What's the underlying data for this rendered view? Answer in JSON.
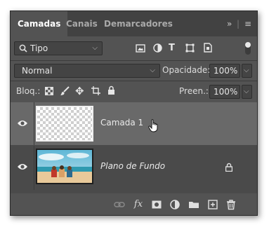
{
  "tabs": {
    "layers": "Camadas",
    "channels": "Canais",
    "paths": "Demarcadores",
    "collapse": "»",
    "menu": "≡"
  },
  "filter": {
    "kind_value": "Tipo"
  },
  "blend": {
    "mode_value": "Normal",
    "opacity_label": "Opacidade:",
    "opacity_value": "100%"
  },
  "lock": {
    "label": "Bloq.:",
    "fill_label": "Preen.:",
    "fill_value": "100%"
  },
  "layers": [
    {
      "name": "Camada 1",
      "selected": true,
      "visible": true,
      "thumbnail": "transparent"
    },
    {
      "name": "Plano de Fundo",
      "selected": false,
      "visible": true,
      "locked": true,
      "thumbnail": "beach-photo"
    }
  ],
  "footer_icons": [
    "link-icon",
    "fx-icon",
    "mask-icon",
    "adjustment-icon",
    "folder-icon",
    "new-layer-icon",
    "trash-icon"
  ]
}
